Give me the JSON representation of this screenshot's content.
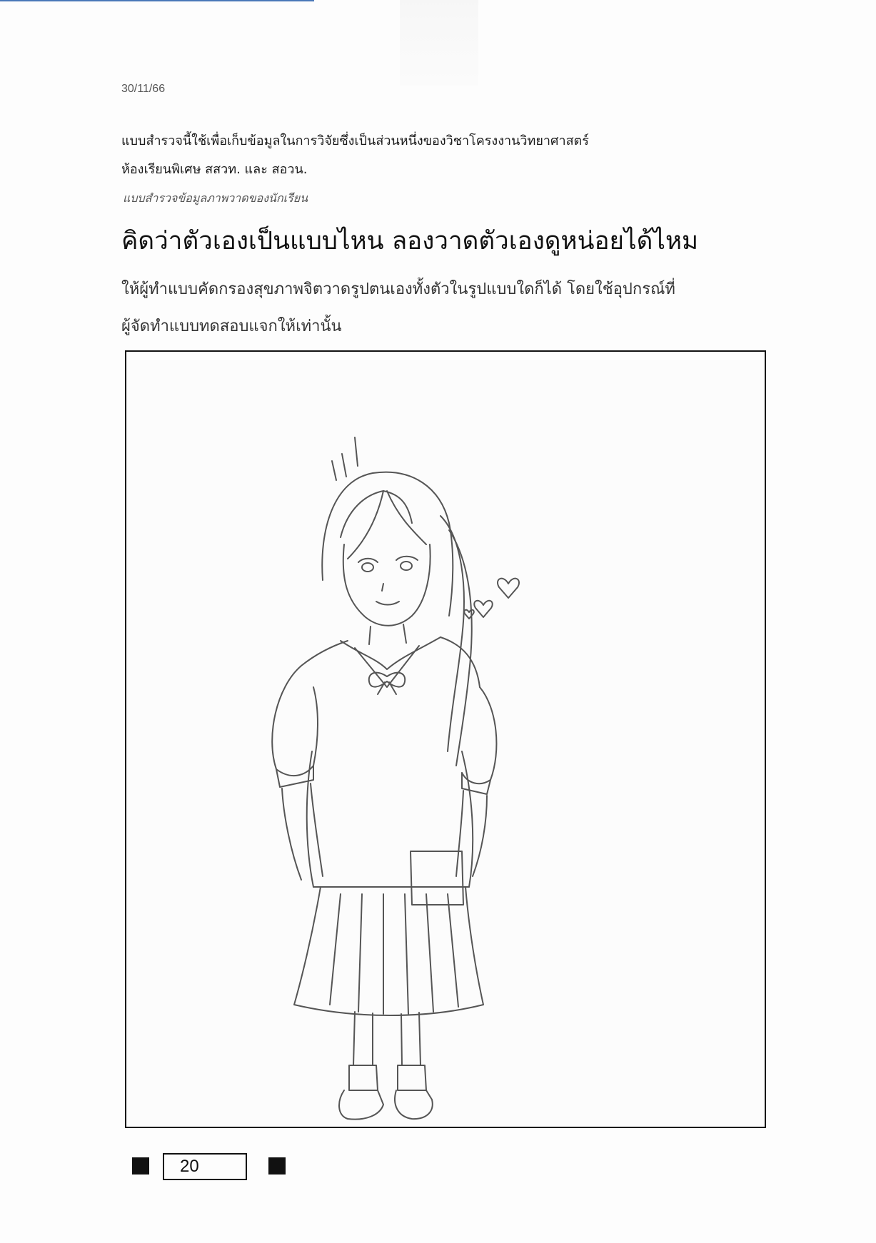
{
  "document": {
    "date": "30/11/66",
    "intro_line1": "แบบสำรวจนี้ใช้เพื่อเก็บข้อมูลในการวิจัยซึ่งเป็นส่วนหนึ่งของวิชาโครงงานวิทยาศาสตร์",
    "intro_line2": "ห้องเรียนพิเศษ สสวท. และ สอวน.",
    "subtitle": "แบบสำรวจข้อมูลภาพวาดของนักเรียน",
    "headline": "คิดว่าตัวเองเป็นแบบไหน ลองวาดตัวเองดูหน่อยได้ไหม",
    "instruction_line1": "ให้ผู้ทำแบบคัดกรองสุขภาพจิตวาดรูปตนเองทั้งตัวในรูปแบบใดก็ได้ โดยใช้อุปกรณ์ที่",
    "instruction_line2": "ผู้จัดทำแบบทดสอบแจกให้เท่านั้น",
    "page_number": "20"
  },
  "drawing": {
    "subject": "pencil-self-portrait-girl-school-uniform",
    "stroke_color": "#555555"
  }
}
